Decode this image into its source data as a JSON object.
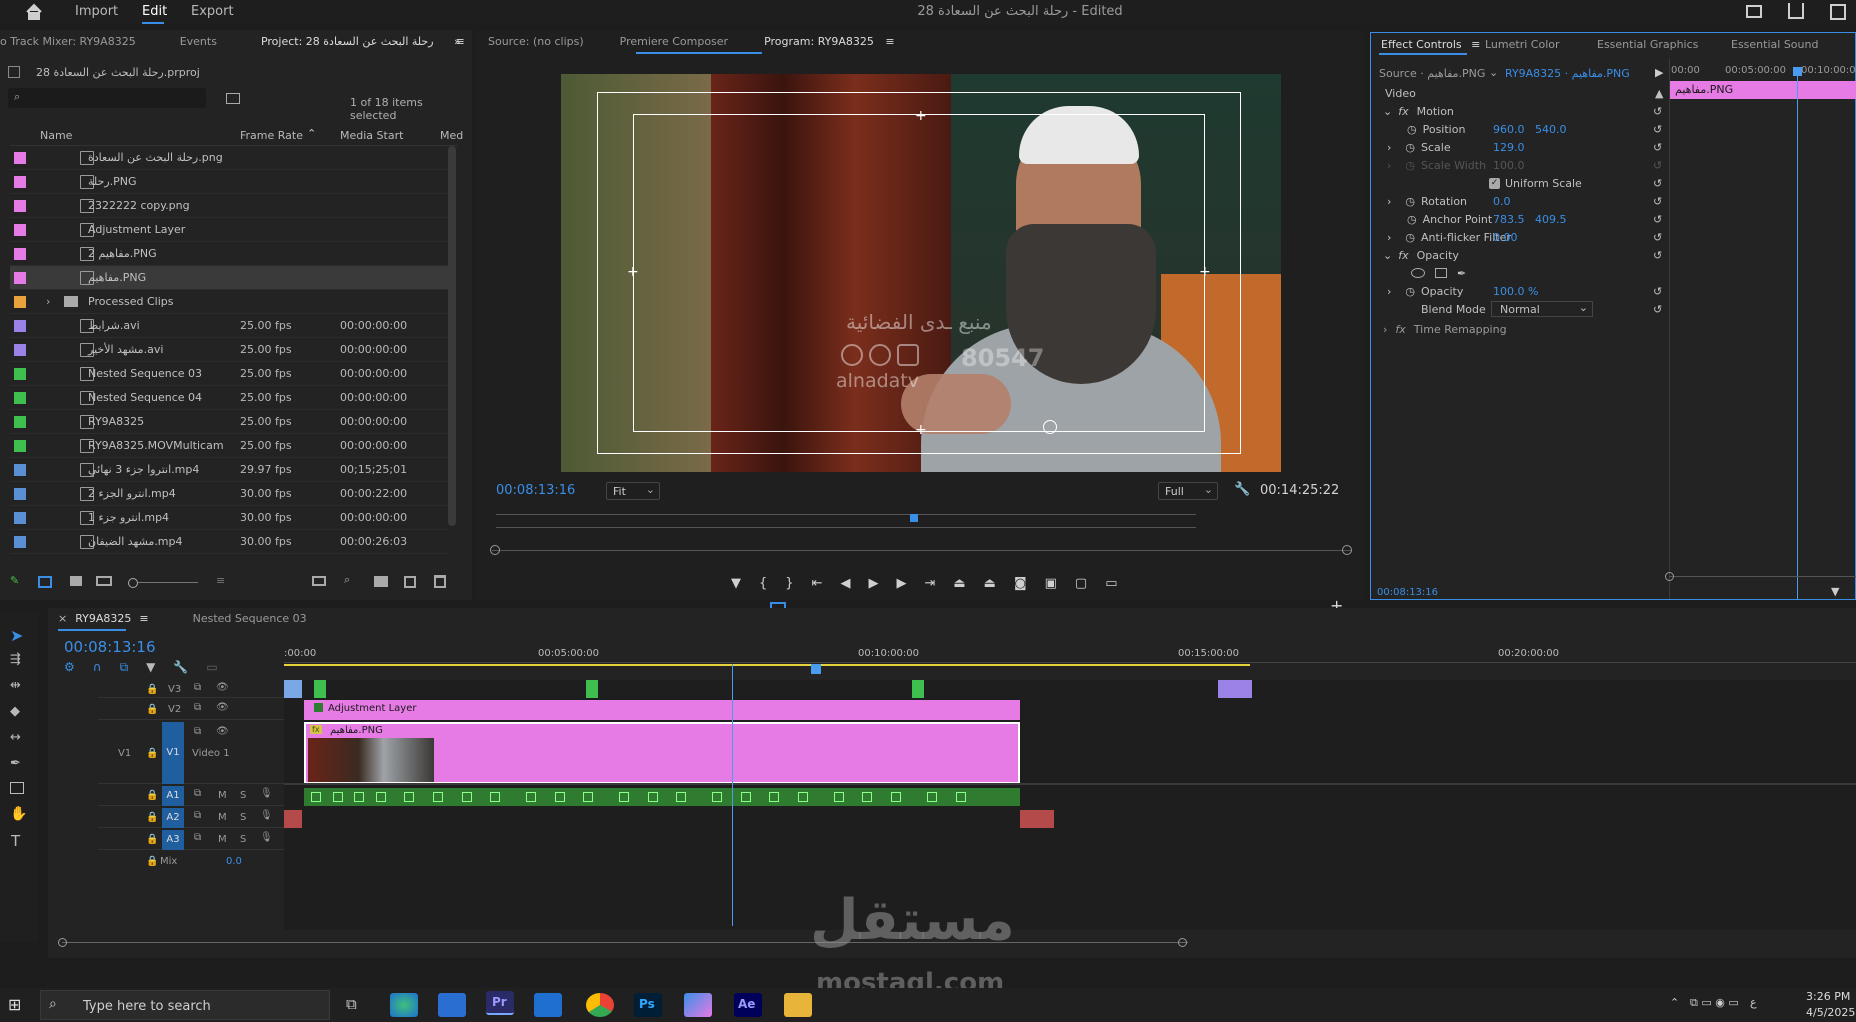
{
  "menu": {
    "import": "Import",
    "edit": "Edit",
    "export": "Export",
    "doc_title": "رحلة البحث عن السعادة 28 - Edited"
  },
  "project": {
    "tabs": [
      "o Track Mixer: RY9A8325",
      "Events",
      "Project: رحلة البحث عن السعادة 28"
    ],
    "file": "رحلة البحث عن السعادة 28.prproj",
    "items_selected": "1 of 18 items selected",
    "headers": {
      "name": "Name",
      "frame_rate": "Frame Rate",
      "media_start": "Media Start",
      "media": "Med"
    },
    "rows": [
      {
        "name": "رحلة البحث عن السعادة.png",
        "fr": "",
        "ms": "",
        "color": "#e67be6"
      },
      {
        "name": "رحلة.PNG",
        "fr": "",
        "ms": "",
        "color": "#e67be6"
      },
      {
        "name": "2322222 copy.png",
        "fr": "",
        "ms": "",
        "color": "#e67be6"
      },
      {
        "name": "Adjustment Layer",
        "fr": "",
        "ms": "",
        "color": "#e67be6"
      },
      {
        "name": "مفاهيم 2.PNG",
        "fr": "",
        "ms": "",
        "color": "#e67be6"
      },
      {
        "name": "مفاهيم.PNG",
        "fr": "",
        "ms": "",
        "color": "#e67be6"
      },
      {
        "name": "Processed Clips",
        "fr": "",
        "ms": "",
        "color": "#e8a33d"
      },
      {
        "name": "شرايط.avi",
        "fr": "25.00 fps",
        "ms": "00:00:00:00",
        "color": "#9a82e6"
      },
      {
        "name": "مشهد الأخير.avi",
        "fr": "25.00 fps",
        "ms": "00:00:00:00",
        "color": "#9a82e6"
      },
      {
        "name": "Nested Sequence 03",
        "fr": "25.00 fps",
        "ms": "00:00:00:00",
        "color": "#3fbf4f"
      },
      {
        "name": "Nested Sequence 04",
        "fr": "25.00 fps",
        "ms": "00:00:00:00",
        "color": "#3fbf4f"
      },
      {
        "name": "RY9A8325",
        "fr": "25.00 fps",
        "ms": "00:00:00:00",
        "color": "#3fbf4f"
      },
      {
        "name": "RY9A8325.MOVMulticam",
        "fr": "25.00 fps",
        "ms": "00:00:00:00",
        "color": "#3fbf4f"
      },
      {
        "name": "انتروا جزء 3 نهائي.mp4",
        "fr": "29.97 fps",
        "ms": "00;15;25;01",
        "color": "#5a8fd6"
      },
      {
        "name": "انترو الجزء 2.mp4",
        "fr": "30.00 fps",
        "ms": "00:00:22:00",
        "color": "#5a8fd6"
      },
      {
        "name": "انترو جزء 1.mp4",
        "fr": "30.00 fps",
        "ms": "00:00:00:00",
        "color": "#5a8fd6"
      },
      {
        "name": "مشهد الضيفان.mp4",
        "fr": "30.00 fps",
        "ms": "00:00:26:03",
        "color": "#5a8fd6"
      }
    ]
  },
  "monitor": {
    "tabs": [
      "Source: (no clips)",
      "Premiere Composer",
      "Program: RY9A8325"
    ],
    "timecode": "00:08:13:16",
    "fit": "Fit",
    "quality": "Full",
    "duration": "00:14:25:22",
    "watermark_ar": "منبع ـدى الفضائية",
    "watermark_num": "80547",
    "watermark_en": "alnadatv"
  },
  "effects": {
    "tabs": [
      "Effect Controls",
      "Lumetri Color",
      "Essential Graphics",
      "Essential Sound"
    ],
    "source": "Source · مفاهيم.PNG",
    "seq": "RY9A8325 · مفاهيم.PNG",
    "ruler": [
      "00:00",
      "00:05:00:00",
      "00:10:00:0"
    ],
    "clip_label": "مفاهيم.PNG",
    "video": "Video",
    "motion": "Motion",
    "position": "Position",
    "pos_x": "960.0",
    "pos_y": "540.0",
    "scale": "Scale",
    "scale_v": "129.0",
    "scale_width": "Scale Width",
    "scale_width_v": "100.0",
    "uniform": "Uniform Scale",
    "rotation": "Rotation",
    "rotation_v": "0.0",
    "anchor": "Anchor Point",
    "anchor_x": "783.5",
    "anchor_y": "409.5",
    "antiflicker": "Anti-flicker Filter",
    "antiflicker_v": "0.00",
    "opacity_h": "Opacity",
    "opacity": "Opacity",
    "opacity_v": "100.0 %",
    "blend": "Blend Mode",
    "blend_v": "Normal",
    "time_remap": "Time Remapping",
    "fx": "fx",
    "timecode": "00:08:13:16"
  },
  "timeline": {
    "tabs": [
      "RY9A8325",
      "Nested Sequence 03"
    ],
    "timecode": "00:08:13:16",
    "ruler": [
      ":00:00",
      "00:05:00:00",
      "00:10:00:00",
      "00:15:00:00",
      "00:20:00:00"
    ],
    "tracks": {
      "v3": "V3",
      "v2": "V2",
      "v1": "V1",
      "v1_label": "Video 1",
      "a1": "A1",
      "a2": "A2",
      "a3": "A3",
      "mix": "Mix",
      "mix_v": "0.0",
      "m": "M",
      "s": "S"
    },
    "clips": {
      "adjustment": "Adjustment Layer",
      "png": "مفاهيم.PNG",
      "fx": "fx"
    }
  },
  "watermark": {
    "arabic": "مستقل",
    "latin": "mostaql.com"
  },
  "taskbar": {
    "search": "Type here to search",
    "time": "3:26 PM",
    "date": "4/5/2025",
    "lang": "ع"
  },
  "colors": {
    "pink": "#e67be6",
    "green": "#3fbf4f",
    "blue": "#3a8ee6",
    "playhead": "#4a9cf0"
  }
}
